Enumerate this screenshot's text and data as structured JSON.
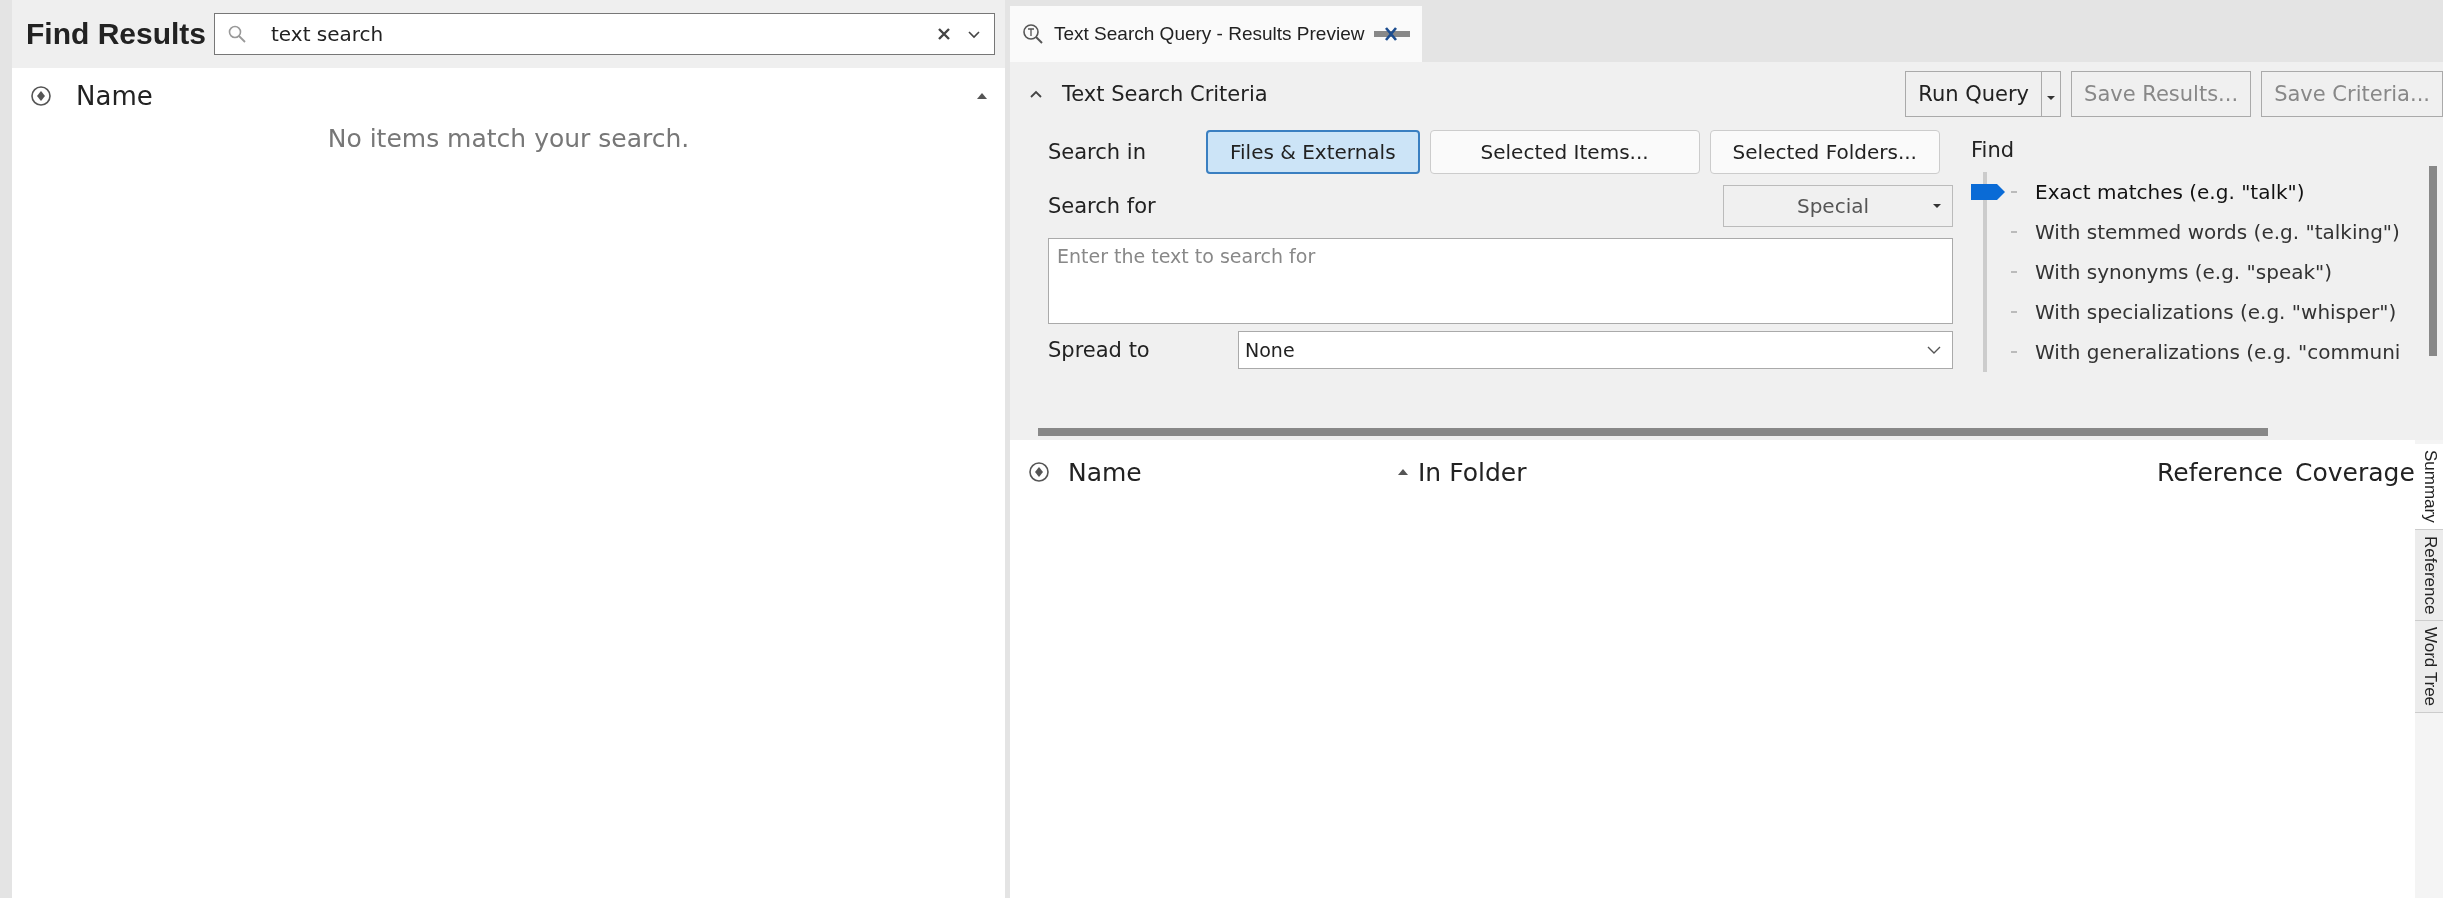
{
  "find_results": {
    "title": "Find Results",
    "search": {
      "value": "text search"
    },
    "columns": [
      {
        "label": "Name",
        "sorted": true
      }
    ],
    "empty_message": "No items match your search."
  },
  "tab": {
    "title": "Text Search Query - Results Preview",
    "selected": true
  },
  "criteria": {
    "title": "Text Search Criteria",
    "expanded": true,
    "buttons": [
      {
        "label": "Run Query",
        "kind": "split",
        "disabled": false
      },
      {
        "label": "Save Results...",
        "kind": "plain",
        "disabled": true
      },
      {
        "label": "Save Criteria...",
        "kind": "plain",
        "disabled": true
      }
    ],
    "search_in_label": "Search in",
    "search_in": [
      {
        "label": "Files & Externals",
        "selected": true
      },
      {
        "label": "Selected Items...",
        "selected": false
      },
      {
        "label": "Selected Folders...",
        "selected": false
      }
    ],
    "special": "Special",
    "search_for_label": "Search for",
    "search_for": {
      "placeholder": "Enter the text to search for"
    },
    "spread_label": "Spread to",
    "spread_value": "None",
    "find_label": "Find",
    "find_options": [
      {
        "label": "Exact matches (e.g. \"talk\")",
        "selected": true
      },
      {
        "label": "With stemmed words (e.g. \"talking\")",
        "selected": false
      },
      {
        "label": "With synonyms (e.g. \"speak\")",
        "selected": false
      },
      {
        "label": "With specializations (e.g. \"whisper\")",
        "selected": false
      },
      {
        "label": "With generalizations (e.g. \"communi",
        "selected": false
      }
    ]
  },
  "results": {
    "columns": [
      {
        "label": "Name",
        "sorted": false
      },
      {
        "label": "In Folder",
        "sorted": true
      },
      {
        "label": "Reference",
        "sorted": false
      },
      {
        "label": "Coverage",
        "sorted": false
      }
    ]
  },
  "side_tabs": [
    {
      "label": "Summary",
      "selected": true
    },
    {
      "label": "Reference",
      "selected": false
    },
    {
      "label": "Word Tree",
      "selected": false
    }
  ]
}
